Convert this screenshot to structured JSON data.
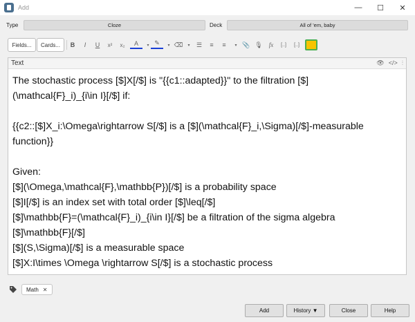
{
  "window": {
    "title": "Add"
  },
  "type_row": {
    "type_label": "Type",
    "type_value": "Cloze",
    "deck_label": "Deck",
    "deck_value": "All of 'em, baby"
  },
  "toolbar": {
    "fields_label": "Fields...",
    "cards_label": "Cards...",
    "bold": "B",
    "italic": "I",
    "underline": "U",
    "superscript": "x²",
    "subscript": "x₂",
    "text_color": "A",
    "highlight": "✎",
    "eraser": "⌫",
    "bullets": "☰",
    "numbers": "≡",
    "align": "≡",
    "attach": "📎",
    "record": "🎙",
    "formula": "fx",
    "cloze": "[..]",
    "cloze_same": "[..]"
  },
  "field": {
    "name": "Text",
    "lines": [
      "The stochastic process [$]X[/$] is \"{{c1::adapted}}\" to the filtration [$]",
      "(\\mathcal{F}_i)_{i\\in I}[/$] if:",
      "",
      "{{c2::[$]X_i:\\Omega\\rightarrow S[/$] is a [$](\\mathcal{F}_i,\\Sigma)[/$]-measurable",
      "function}}",
      "",
      "Given:",
      "[$](\\Omega,\\mathcal{F},\\mathbb{P})[/$] is a probability space",
      "[$]I[/$] is an index set with total order [$]\\leq[/$]",
      "[$]\\mathbb{F}=(\\mathcal{F}_i)_{i\\in I}[/$] be a filtration of the sigma algebra",
      "[$]\\mathbb{F}[/$]",
      "[$](S,\\Sigma)[/$] is a measurable space",
      "[$]X:I\\times \\Omega \\rightarrow S[/$] is a stochastic process"
    ]
  },
  "tags": {
    "items": [
      "Math"
    ]
  },
  "buttons": {
    "add": "Add",
    "history": "History ▼",
    "close": "Close",
    "help": "Help"
  }
}
